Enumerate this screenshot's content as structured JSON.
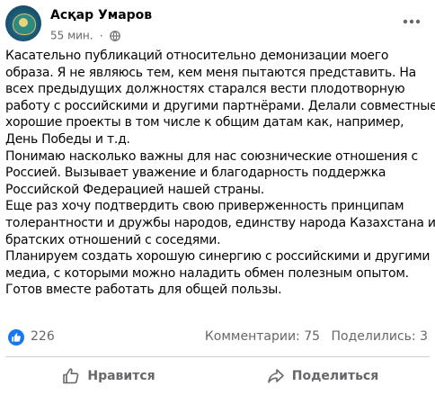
{
  "post": {
    "author": "Асқар Умаров",
    "time": "55 мин.",
    "separator": "·",
    "privacy_icon": "globe-icon",
    "more_icon": "more-icon",
    "body_paragraphs": [
      [
        "Касательно публикаций относительно демонизации моего",
        "образа. Я не являюсь тем, кем меня пытаются представить. На",
        "всех предыдущих должностях старался вести плодотворную",
        "работу с российскими и другими партнёрами. Делали совместные",
        "хорошие проекты в том числе к общим датам как, например,",
        "День Победы и т.д."
      ],
      [
        "Понимаю насколько важны для  нас союзнические отношения с",
        "Россией. Вызывает уважение и благодарность  поддержка",
        "Российской Федерацией нашей страны."
      ],
      [
        "Еще раз хочу подтвердить свою приверженность принципам",
        "толерантности и дружбы народов, единству народа Казахстана и",
        "братских отношений с соседями."
      ],
      [
        "Планируем создать хорошую синергию с российскими и другими",
        "медиа, с которыми можно наладить обмен полезным опытом.",
        "Готов вместе работать для общей пользы."
      ]
    ],
    "reactions": {
      "icon": "like-icon",
      "count": "226"
    },
    "comments_label": "Комментарии: 75",
    "shares_label": "Поделились: 3",
    "actions": {
      "like_label": "Нравится",
      "like_icon": "thumbs-up-icon",
      "share_label": "Поделиться",
      "share_icon": "share-arrow-icon"
    },
    "colors": {
      "like_blue": "#1877f2",
      "secondary_text": "#65676b",
      "divider": "#ced0d4"
    }
  }
}
